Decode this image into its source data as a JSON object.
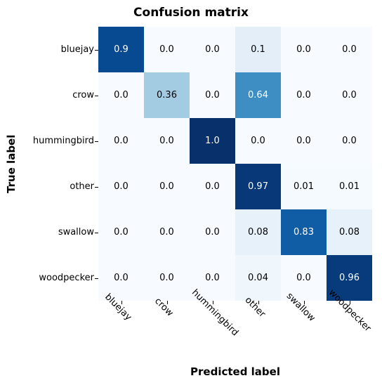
{
  "chart_data": {
    "type": "heatmap",
    "title": "Confusion matrix",
    "xlabel": "Predicted label",
    "ylabel": "True label",
    "categories": [
      "bluejay",
      "crow",
      "hummingbird",
      "other",
      "swallow",
      "woodpecker"
    ],
    "matrix": [
      [
        0.9,
        0.0,
        0.0,
        0.1,
        0.0,
        0.0
      ],
      [
        0.0,
        0.36,
        0.0,
        0.64,
        0.0,
        0.0
      ],
      [
        0.0,
        0.0,
        1.0,
        0.0,
        0.0,
        0.0
      ],
      [
        0.0,
        0.0,
        0.0,
        0.97,
        0.01,
        0.01
      ],
      [
        0.0,
        0.0,
        0.0,
        0.08,
        0.83,
        0.08
      ],
      [
        0.0,
        0.0,
        0.0,
        0.04,
        0.0,
        0.96
      ]
    ],
    "value_range": [
      0.0,
      1.0
    ],
    "colormap": "Blues"
  }
}
